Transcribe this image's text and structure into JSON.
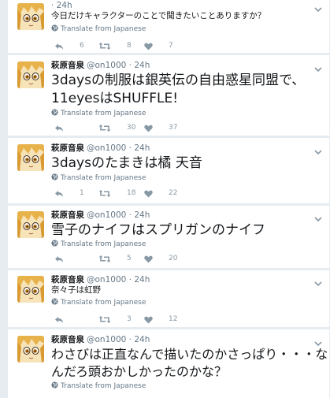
{
  "user": {
    "name": "萩原音泉",
    "handle": "@on1000"
  },
  "translate_label": "Translate from Japanese",
  "tweets": [
    {
      "time": "· 24h",
      "text": "今日だけキャラクターのことで聞きたいことありますか？",
      "reply_count": "6",
      "retweet_count": "8",
      "like_count": "7"
    },
    {
      "time": "· 24h",
      "text_line1": "3daysの制服は銀英伝の自由惑星同盟で、",
      "text_line2": "11eyesはSHUFFLE!",
      "reply_count": "",
      "retweet_count": "30",
      "like_count": "37"
    },
    {
      "time": "· 24h",
      "text": "3daysのたまきは橘 天音",
      "reply_count": "1",
      "retweet_count": "18",
      "like_count": "22"
    },
    {
      "time": "· 24h",
      "text": "雪子のナイフはスプリガンのナイフ",
      "reply_count": "",
      "retweet_count": "5",
      "like_count": "20"
    },
    {
      "time": "· 24h",
      "text": "奈々子は虹野",
      "reply_count": "",
      "retweet_count": "3",
      "like_count": "12"
    },
    {
      "time": "· 24h",
      "text_line1": "わさびは正直なんで描いたのかさっぱり・・・な",
      "text_line2": "んだろ頭おかしかったのかな？"
    }
  ]
}
